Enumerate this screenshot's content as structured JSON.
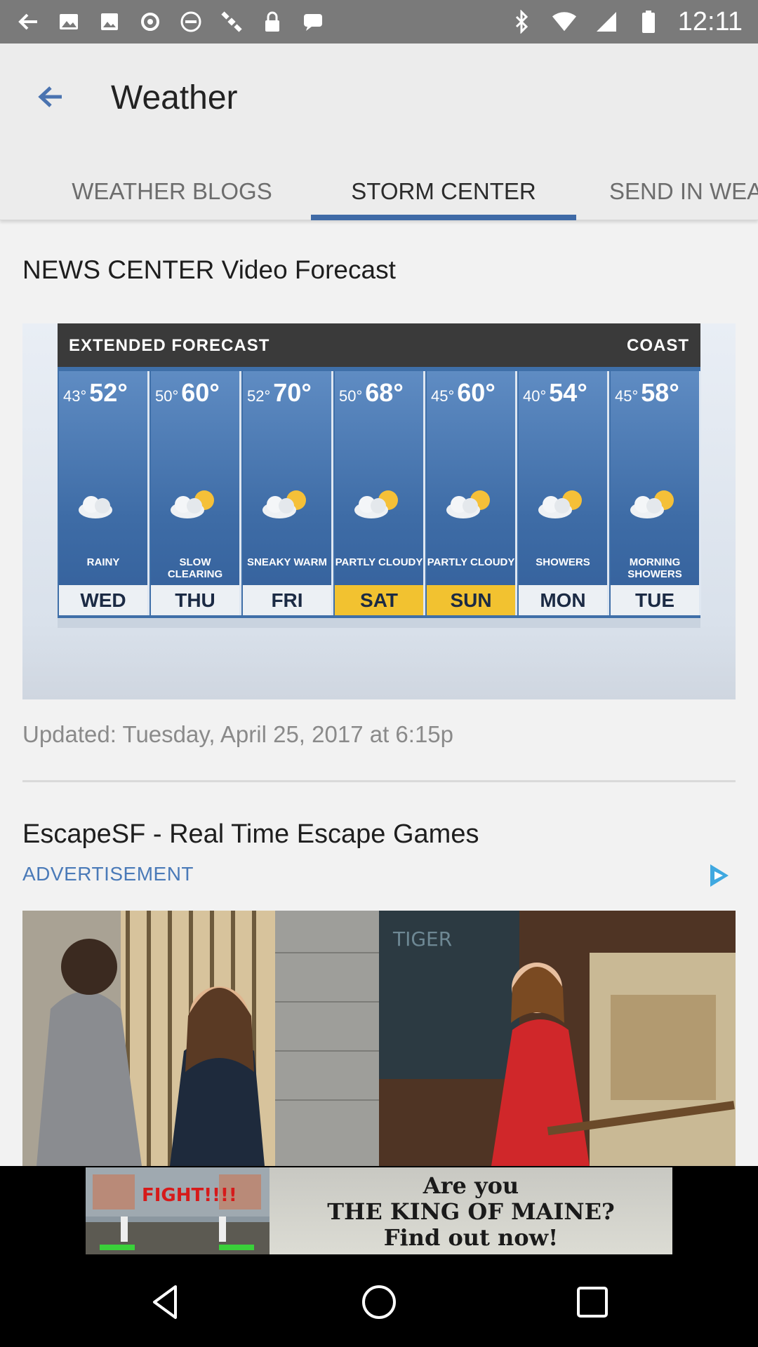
{
  "status_bar": {
    "time": "12:11",
    "left_icons": [
      "back-arrow-icon",
      "gallery-icon",
      "image-icon",
      "circle-icon",
      "no-disturb-icon",
      "satellite-icon",
      "lock-icon",
      "message-icon"
    ],
    "right_icons": [
      "bluetooth-icon",
      "wifi-icon",
      "signal-icon",
      "battery-icon"
    ]
  },
  "header": {
    "title": "Weather",
    "tabs": [
      {
        "label": "WEATHER BLOGS",
        "active": false
      },
      {
        "label": "STORM CENTER",
        "active": true
      },
      {
        "label": "SEND IN WEA",
        "active": false
      }
    ]
  },
  "main": {
    "video_section_title": "NEWS CENTER Video Forecast",
    "forecast_image": {
      "heading": "EXTENDED FORECAST",
      "region": "COAST",
      "days": [
        {
          "day": "WED",
          "lo": "43°",
          "hi": "52°",
          "desc": "RAINY",
          "weekend": false
        },
        {
          "day": "THU",
          "lo": "50°",
          "hi": "60°",
          "desc": "SLOW CLEARING",
          "weekend": false
        },
        {
          "day": "FRI",
          "lo": "52°",
          "hi": "70°",
          "desc": "SNEAKY WARM",
          "weekend": false
        },
        {
          "day": "SAT",
          "lo": "50°",
          "hi": "68°",
          "desc": "PARTLY CLOUDY",
          "weekend": true
        },
        {
          "day": "SUN",
          "lo": "45°",
          "hi": "60°",
          "desc": "PARTLY CLOUDY",
          "weekend": true
        },
        {
          "day": "MON",
          "lo": "40°",
          "hi": "54°",
          "desc": "SHOWERS",
          "weekend": false
        },
        {
          "day": "TUE",
          "lo": "45°",
          "hi": "58°",
          "desc": "MORNING SHOWERS",
          "weekend": false
        }
      ]
    },
    "updated_text": "Updated: Tuesday, April 25, 2017 at 6:15p",
    "ad": {
      "title": "EscapeSF - Real Time Escape Games",
      "label": "ADVERTISEMENT",
      "sign_text": "TIGER"
    }
  },
  "banner_ad": {
    "game_text": "FIGHT!!!!",
    "line1": "Are you",
    "line2": "THE KING OF MAINE?",
    "line3": "Find out now!"
  },
  "nav_bar": {
    "icons": [
      "back-nav-icon",
      "home-nav-icon",
      "recents-nav-icon"
    ]
  }
}
